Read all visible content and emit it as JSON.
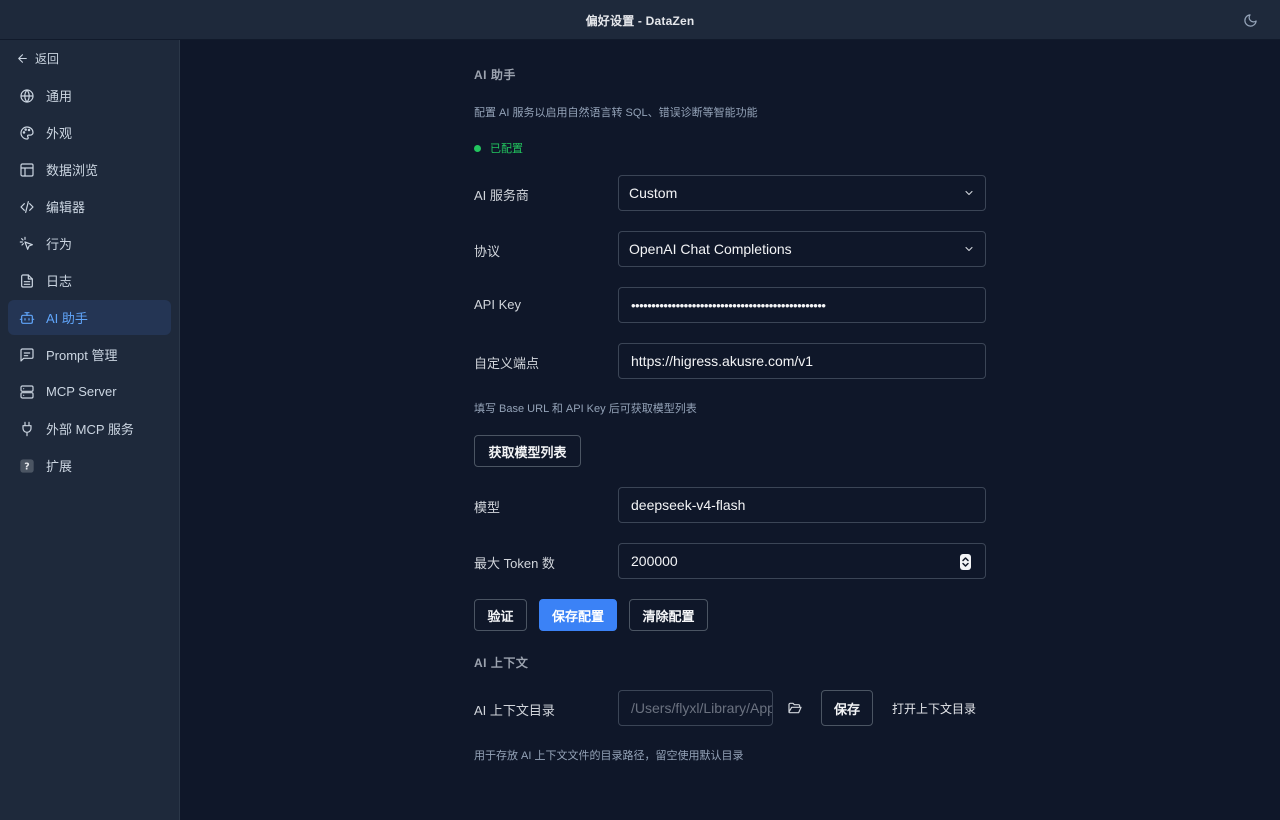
{
  "window": {
    "title": "偏好设置 - DataZen",
    "theme_icon": "moon-icon"
  },
  "sidebar": {
    "back_label": "返回",
    "items": [
      {
        "label": "通用",
        "icon": "globe-icon"
      },
      {
        "label": "外观",
        "icon": "palette-icon"
      },
      {
        "label": "数据浏览",
        "icon": "table-icon"
      },
      {
        "label": "编辑器",
        "icon": "code-icon"
      },
      {
        "label": "行为",
        "icon": "pointer-icon"
      },
      {
        "label": "日志",
        "icon": "file-icon"
      },
      {
        "label": "AI 助手",
        "icon": "bot-icon",
        "active": true
      },
      {
        "label": "Prompt 管理",
        "icon": "message-icon"
      },
      {
        "label": "MCP Server",
        "icon": "server-icon"
      },
      {
        "label": "外部 MCP 服务",
        "icon": "plug-icon"
      },
      {
        "label": "扩展",
        "icon": "help-icon"
      }
    ]
  },
  "ai": {
    "section_title": "AI 助手",
    "description": "配置 AI 服务以启用自然语言转 SQL、错误诊断等智能功能",
    "status": "已配置",
    "provider": {
      "label": "AI 服务商",
      "value": "Custom"
    },
    "protocol": {
      "label": "协议",
      "value": "OpenAI Chat Completions"
    },
    "api_key": {
      "label": "API Key",
      "value": "••••••••••••••••••••••••••••••••••••••••••••••••"
    },
    "endpoint": {
      "label": "自定义端点",
      "value": "https://higress.akusre.com/v1"
    },
    "hint": "填写 Base URL 和 API Key 后可获取模型列表",
    "fetch_models_label": "获取模型列表",
    "model": {
      "label": "模型",
      "value": "deepseek-v4-flash"
    },
    "max_tokens": {
      "label": "最大 Token 数",
      "value": "200000"
    },
    "buttons": {
      "verify": "验证",
      "save": "保存配置",
      "clear": "清除配置"
    }
  },
  "context": {
    "section_title": "AI 上下文",
    "dir_label": "AI 上下文目录",
    "dir_placeholder": "/Users/flyxl/Library/Application Support/DataZen/ai-context",
    "save_label": "保存",
    "open_label": "打开上下文目录",
    "hint": "用于存放 AI 上下文文件的目录路径，留空使用默认目录"
  },
  "colors": {
    "accent": "#3b82f6",
    "success": "#22c55e",
    "background": "#0f1729",
    "sidebar": "#1e293b"
  }
}
